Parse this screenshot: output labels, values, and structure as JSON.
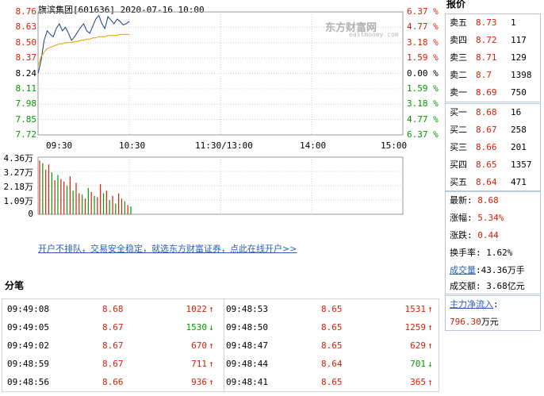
{
  "header": {
    "title": "旗滨集团[601636] 2020-07-16 10:00"
  },
  "logo": {
    "text": "东方财富网",
    "sub": "eastmoney.com"
  },
  "chart_data": [
    {
      "type": "line",
      "title": "旗滨集团[601636] 2020-07-16 10:00",
      "x_ticks": [
        "09:30",
        "10:30",
        "11:30/13:00",
        "14:00",
        "15:00"
      ],
      "y_ticks": [
        "8.76",
        "8.63",
        "8.50",
        "8.37",
        "8.24",
        "8.11",
        "7.98",
        "7.85",
        "7.72"
      ],
      "y_ticks_right": [
        "6.37 %",
        "4.77 %",
        "3.18 %",
        "1.59 %",
        "0.00 %",
        "1.59 %",
        "3.18 %",
        "4.77 %",
        "6.37 %"
      ],
      "ylim": [
        7.72,
        8.76
      ],
      "series": [
        {
          "x": [
            0,
            1,
            2,
            3,
            4,
            5,
            6,
            7,
            8,
            9,
            10,
            11,
            12,
            13,
            14,
            15,
            16,
            17,
            18,
            19,
            20,
            21,
            22,
            23,
            24,
            25,
            26,
            27,
            28,
            29,
            30
          ],
          "values": [
            8.24,
            8.35,
            8.52,
            8.6,
            8.57,
            8.55,
            8.62,
            8.66,
            8.6,
            8.63,
            8.58,
            8.52,
            8.55,
            8.59,
            8.63,
            8.66,
            8.6,
            8.58,
            8.64,
            8.7,
            8.73,
            8.66,
            8.62,
            8.72,
            8.69,
            8.66,
            8.7,
            8.68,
            8.65,
            8.66,
            8.68
          ],
          "color": "#1a3a8c"
        },
        {
          "x": [
            0,
            1,
            2,
            3,
            4,
            5,
            6,
            7,
            8,
            9,
            10,
            11,
            12,
            13,
            14,
            15,
            16,
            17,
            18,
            19,
            20,
            21,
            22,
            23,
            24,
            25,
            26,
            27,
            28,
            29,
            30
          ],
          "values": [
            8.3,
            8.38,
            8.42,
            8.45,
            8.46,
            8.47,
            8.48,
            8.49,
            8.49,
            8.5,
            8.5,
            8.5,
            8.51,
            8.51,
            8.52,
            8.52,
            8.53,
            8.53,
            8.54,
            8.54,
            8.55,
            8.55,
            8.55,
            8.56,
            8.56,
            8.56,
            8.56,
            8.57,
            8.57,
            8.57,
            8.57
          ],
          "color": "#e0a000"
        }
      ]
    },
    {
      "type": "bar",
      "y_ticks": [
        "4.36万",
        "3.27万",
        "2.18万",
        "1.09万",
        "0"
      ],
      "ylim": [
        0,
        4.36
      ],
      "values": [
        4.1,
        3.9,
        3.4,
        3.8,
        3.2,
        2.6,
        3.0,
        2.7,
        2.5,
        2.2,
        2.9,
        1.8,
        2.4,
        1.6,
        1.5,
        1.2,
        2.0,
        1.7,
        1.4,
        1.3,
        2.3,
        1.6,
        1.8,
        1.1,
        1.4,
        0.8,
        1.6,
        1.2,
        1.0,
        0.7,
        0.6
      ],
      "colors": [
        "red",
        "green",
        "red",
        "red",
        "green",
        "red",
        "green",
        "red",
        "red",
        "green",
        "red",
        "green",
        "red",
        "red",
        "green",
        "red",
        "green",
        "red",
        "green",
        "red",
        "red",
        "green",
        "red",
        "green",
        "red",
        "green",
        "red",
        "red",
        "green",
        "red",
        "green"
      ]
    }
  ],
  "promo": {
    "text": "开户不排队，交易安全稳定，就选东方财富证券，点此在线开户>>"
  },
  "fenbi": {
    "title": "分笔",
    "left": [
      {
        "time": "09:49:08",
        "price": "8.68",
        "vol": "1022",
        "dir": "up"
      },
      {
        "time": "09:49:05",
        "price": "8.67",
        "vol": "1530",
        "dir": "down"
      },
      {
        "time": "09:49:02",
        "price": "8.67",
        "vol": "670",
        "dir": "up"
      },
      {
        "time": "09:48:59",
        "price": "8.67",
        "vol": "711",
        "dir": "up"
      },
      {
        "time": "09:48:56",
        "price": "8.66",
        "vol": "936",
        "dir": "up"
      }
    ],
    "right": [
      {
        "time": "09:48:53",
        "price": "8.65",
        "vol": "1531",
        "dir": "up"
      },
      {
        "time": "09:48:50",
        "price": "8.65",
        "vol": "1259",
        "dir": "up"
      },
      {
        "time": "09:48:47",
        "price": "8.65",
        "vol": "629",
        "dir": "up"
      },
      {
        "time": "09:48:44",
        "price": "8.64",
        "vol": "701",
        "dir": "down"
      },
      {
        "time": "09:48:41",
        "price": "8.65",
        "vol": "365",
        "dir": "up"
      }
    ]
  },
  "quote": {
    "title": "报价",
    "sells": [
      {
        "label": "卖五",
        "price": "8.73",
        "vol": "1"
      },
      {
        "label": "卖四",
        "price": "8.72",
        "vol": "117"
      },
      {
        "label": "卖三",
        "price": "8.71",
        "vol": "129"
      },
      {
        "label": "卖二",
        "price": "8.7",
        "vol": "1398"
      },
      {
        "label": "卖一",
        "price": "8.69",
        "vol": "750"
      }
    ],
    "buys": [
      {
        "label": "买一",
        "price": "8.68",
        "vol": "16"
      },
      {
        "label": "买二",
        "price": "8.67",
        "vol": "258"
      },
      {
        "label": "买三",
        "price": "8.66",
        "vol": "201"
      },
      {
        "label": "买四",
        "price": "8.65",
        "vol": "1357"
      },
      {
        "label": "买五",
        "price": "8.64",
        "vol": "471"
      }
    ],
    "latest_label": "最新:",
    "latest": "8.68",
    "change_pct_label": "涨幅:",
    "change_pct": "5.34%",
    "change_label": "涨跌:",
    "change": "0.44",
    "turnover_label": "换手率:",
    "turnover": "1.62%",
    "volume_label": "成交量",
    "volume": ":43.36万手",
    "amount_label": "成交额:",
    "amount": "3.68亿元",
    "netflow_label": "主力净流入",
    "netflow_colon": ":",
    "netflow_value": "796.30",
    "netflow_unit": "万元"
  },
  "colors": {
    "up": "#d81e06",
    "down": "#009900",
    "grid": "#cccccc",
    "price_line": "#1a3a8c",
    "avg_line": "#e0a000"
  }
}
